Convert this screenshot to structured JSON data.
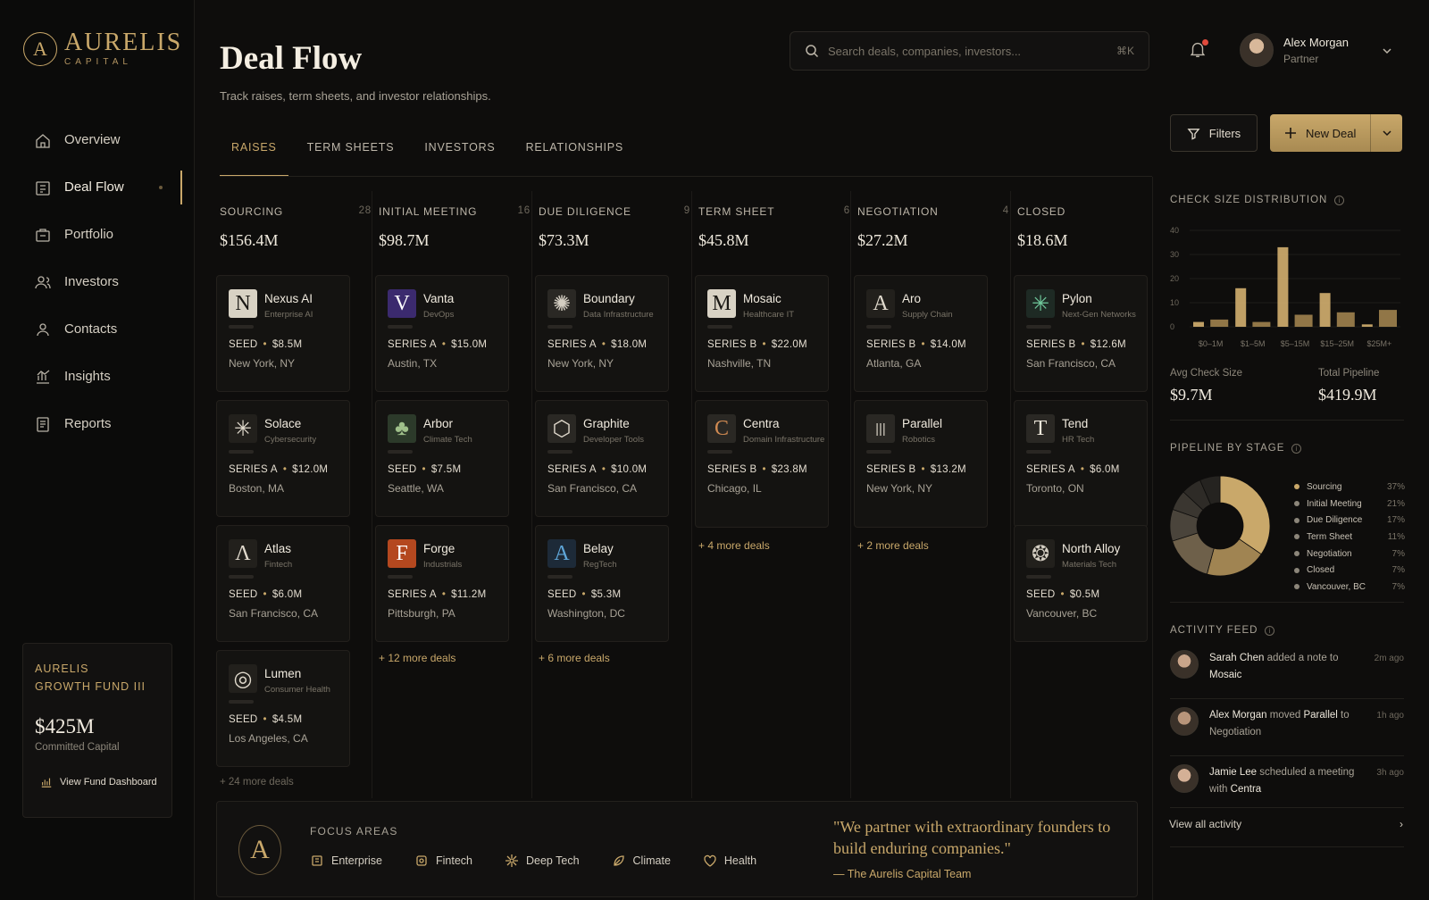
{
  "brand": {
    "name": "AURELIS",
    "sub": "CAPITAL"
  },
  "nav": [
    {
      "label": "Overview",
      "icon": "home-icon"
    },
    {
      "label": "Deal Flow",
      "icon": "deal-flow-icon",
      "active": true
    },
    {
      "label": "Portfolio",
      "icon": "portfolio-icon"
    },
    {
      "label": "Investors",
      "icon": "investors-icon"
    },
    {
      "label": "Contacts",
      "icon": "contacts-icon"
    },
    {
      "label": "Insights",
      "icon": "insights-icon"
    },
    {
      "label": "Reports",
      "icon": "reports-icon"
    }
  ],
  "fund": {
    "name_line1": "AURELIS",
    "name_line2": "GROWTH FUND III",
    "amount": "$425M",
    "label": "Committed Capital",
    "link": "View Fund Dashboard"
  },
  "header": {
    "title": "Deal Flow",
    "subtitle": "Track raises, term sheets, and investor relationships.",
    "search_placeholder": "Search deals, companies, investors...",
    "search_shortcut": "⌘K"
  },
  "user": {
    "name": "Alex Morgan",
    "role": "Partner"
  },
  "tabs": [
    "RAISES",
    "TERM SHEETS",
    "INVESTORS",
    "RELATIONSHIPS"
  ],
  "actions": {
    "filters": "Filters",
    "new_deal": "New Deal"
  },
  "columns": [
    {
      "name": "SOURCING",
      "count": "28",
      "total": "$156.4M",
      "cards": [
        {
          "name": "Nexus AI",
          "sector": "Enterprise AI",
          "logo": "N",
          "logo_bg": "#d8d2c4",
          "logo_fg": "#1a1814",
          "round": "SEED",
          "amount": "$8.5M",
          "location": "New York, NY"
        },
        {
          "name": "Solace",
          "sector": "Cybersecurity",
          "logo": "✳",
          "logo_bg": "#22201c",
          "logo_fg": "#e0d9cc",
          "round": "SERIES A",
          "amount": "$12.0M",
          "location": "Boston, MA"
        },
        {
          "name": "Atlas",
          "sector": "Fintech",
          "logo": "Λ",
          "logo_bg": "#22201c",
          "logo_fg": "#e0d9cc",
          "round": "SEED",
          "amount": "$6.0M",
          "location": "San Francisco, CA"
        },
        {
          "name": "Lumen",
          "sector": "Consumer Health",
          "logo": "◎",
          "logo_bg": "#22201c",
          "logo_fg": "#e0d9cc",
          "round": "SEED",
          "amount": "$4.5M",
          "location": "Los Angeles, CA"
        }
      ],
      "more": "+ 24 more deals"
    },
    {
      "name": "INITIAL MEETING",
      "count": "16",
      "total": "$98.7M",
      "cards": [
        {
          "name": "Vanta",
          "sector": "DevOps",
          "logo": "V",
          "logo_bg": "#3b2a6e",
          "logo_fg": "#ffffff",
          "round": "SERIES A",
          "amount": "$15.0M",
          "location": "Austin, TX"
        },
        {
          "name": "Arbor",
          "sector": "Climate Tech",
          "logo": "♣",
          "logo_bg": "#2c3a2a",
          "logo_fg": "#9fc08a",
          "round": "SEED",
          "amount": "$7.5M",
          "location": "Seattle, WA"
        },
        {
          "name": "Forge",
          "sector": "Industrials",
          "logo": "F",
          "logo_bg": "#b4481f",
          "logo_fg": "#ffffff",
          "round": "SERIES A",
          "amount": "$11.2M",
          "location": "Pittsburgh, PA"
        }
      ],
      "more": "+ 12 more deals"
    },
    {
      "name": "DUE DILIGENCE",
      "count": "9",
      "total": "$73.3M",
      "cards": [
        {
          "name": "Boundary",
          "sector": "Data Infrastructure",
          "logo": "✺",
          "logo_bg": "#2a2824",
          "logo_fg": "#d4cec2",
          "round": "SERIES A",
          "amount": "$18.0M",
          "location": "New York, NY"
        },
        {
          "name": "Graphite",
          "sector": "Developer Tools",
          "logo": "⬡",
          "logo_bg": "#2a2824",
          "logo_fg": "#e0d9cc",
          "round": "SERIES A",
          "amount": "$10.0M",
          "location": "San Francisco, CA"
        },
        {
          "name": "Belay",
          "sector": "RegTech",
          "logo": "A",
          "logo_bg": "#1d2a38",
          "logo_fg": "#5fa6d8",
          "round": "SEED",
          "amount": "$5.3M",
          "location": "Washington, DC"
        }
      ],
      "more": "+ 6 more deals"
    },
    {
      "name": "TERM SHEET",
      "count": "6",
      "total": "$45.8M",
      "cards": [
        {
          "name": "Mosaic",
          "sector": "Healthcare IT",
          "logo": "M",
          "logo_bg": "#d8d2c4",
          "logo_fg": "#1a1814",
          "round": "SERIES B",
          "amount": "$22.0M",
          "location": "Nashville, TN"
        },
        {
          "name": "Centra",
          "sector": "Domain Infrastructure",
          "logo": "C",
          "logo_bg": "#2a2824",
          "logo_fg": "#d08a52",
          "round": "SERIES B",
          "amount": "$23.8M",
          "location": "Chicago, IL"
        }
      ],
      "more": "+ 4 more deals"
    },
    {
      "name": "NEGOTIATION",
      "count": "4",
      "total": "$27.2M",
      "cards": [
        {
          "name": "Aro",
          "sector": "Supply Chain",
          "logo": "A",
          "logo_bg": "#22201c",
          "logo_fg": "#e0d9cc",
          "round": "SERIES B",
          "amount": "$14.0M",
          "location": "Atlanta, GA"
        },
        {
          "name": "Parallel",
          "sector": "Robotics",
          "logo": "|||",
          "logo_bg": "#2a2824",
          "logo_fg": "#d4cec2",
          "round": "SERIES B",
          "amount": "$13.2M",
          "location": "New York, NY"
        }
      ],
      "more": "+ 2 more deals"
    },
    {
      "name": "CLOSED",
      "count": "",
      "total": "$18.6M",
      "cards": [
        {
          "name": "Pylon",
          "sector": "Next-Gen Networks",
          "logo": "✳",
          "logo_bg": "#1e2a24",
          "logo_fg": "#6fc79a",
          "round": "SERIES B",
          "amount": "$12.6M",
          "location": "San Francisco, CA"
        },
        {
          "name": "Tend",
          "sector": "HR Tech",
          "logo": "T",
          "logo_bg": "#2a2824",
          "logo_fg": "#ece6da",
          "round": "SERIES A",
          "amount": "$6.0M",
          "location": "Toronto, ON"
        },
        {
          "name": "North Alloy",
          "sector": "Materials Tech",
          "logo": "❂",
          "logo_bg": "#22201c",
          "logo_fg": "#d4cec2",
          "round": "SEED",
          "amount": "$0.5M",
          "location": "Vancouver, BC"
        }
      ],
      "more": ""
    }
  ],
  "focus": {
    "title": "FOCUS AREAS",
    "items": [
      {
        "label": "Enterprise",
        "icon": "enterprise-icon"
      },
      {
        "label": "Fintech",
        "icon": "fintech-icon"
      },
      {
        "label": "Deep Tech",
        "icon": "deep-tech-icon"
      },
      {
        "label": "Climate",
        "icon": "climate-icon"
      },
      {
        "label": "Health",
        "icon": "health-icon"
      }
    ],
    "quote": "\"We partner with extraordinary founders to build enduring companies.\"",
    "quote_by": "— The Aurelis Capital Team"
  },
  "panel": {
    "check_title": "CHECK SIZE DISTRIBUTION",
    "avg_label": "Avg Check Size",
    "avg_value": "$9.7M",
    "total_label": "Total Pipeline",
    "total_value": "$419.9M",
    "pipeline_title": "PIPELINE BY STAGE",
    "activity_title": "ACTIVITY FEED",
    "view_all": "View all activity"
  },
  "chart_data": [
    {
      "type": "bar",
      "title": "CHECK SIZE DISTRIBUTION",
      "categories": [
        "$0–1M",
        "$1–5M",
        "$5–15M",
        "$15–25M",
        "$25M+"
      ],
      "series": [
        {
          "values": [
            2,
            16,
            33,
            14,
            1
          ]
        },
        {
          "values": [
            3,
            2,
            5,
            6,
            7
          ]
        }
      ],
      "yticks": [
        0,
        10,
        20,
        30,
        40
      ],
      "ylim": [
        0,
        40
      ]
    },
    {
      "type": "pie",
      "title": "PIPELINE BY STAGE",
      "labels": [
        "Sourcing",
        "Initial Meeting",
        "Due Diligence",
        "Term Sheet",
        "Negotiation",
        "Closed",
        "Vancouver, BC"
      ],
      "values": [
        37,
        21,
        17,
        11,
        7,
        7,
        7
      ],
      "display": [
        "37%",
        "21%",
        "17%",
        "11%",
        "7%",
        "7%",
        "7%"
      ],
      "colors": [
        "#c9a86a",
        "#a08452",
        "#6e604a",
        "#4a443b",
        "#3a3630",
        "#2e2b27",
        "#252320"
      ]
    }
  ],
  "activity": [
    {
      "user": "Sarah Chen",
      "action": " added a note to ",
      "target": "Mosaic",
      "time": "2m ago"
    },
    {
      "user": "Alex Morgan",
      "action": " moved ",
      "target": "Parallel",
      "suffix": " to Negotiation",
      "time": "1h ago"
    },
    {
      "user": "Jamie Lee",
      "action": " scheduled a meeting with ",
      "target": "Centra",
      "time": "3h ago"
    }
  ]
}
